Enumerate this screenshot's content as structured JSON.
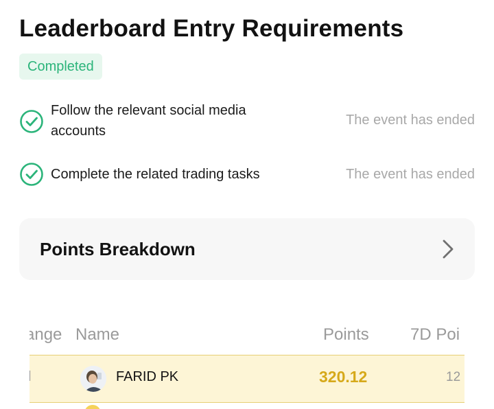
{
  "header": {
    "title": "Leaderboard Entry Requirements",
    "badge": "Completed"
  },
  "requirements": [
    {
      "text": "Follow the relevant social media accounts",
      "status": "The event has ended"
    },
    {
      "text": "Complete the related trading tasks",
      "status": "The event has ended"
    }
  ],
  "points_card": {
    "label": "Points Breakdown"
  },
  "table": {
    "headers": [
      "ange",
      "Name",
      "Points",
      "7D Poi"
    ],
    "rows": [
      {
        "rank_fragment": "l",
        "name": "FARID PK",
        "points": "320.12",
        "points_7d_fragment": "12"
      }
    ]
  },
  "colors": {
    "accent_green": "#2bb47a",
    "badge_bg": "#e7f7ee",
    "highlight_row": "#fdf5d6",
    "points_gold": "#d6a91a"
  },
  "icons": {
    "check": "check-circle-icon",
    "chevron": "chevron-right-icon"
  }
}
